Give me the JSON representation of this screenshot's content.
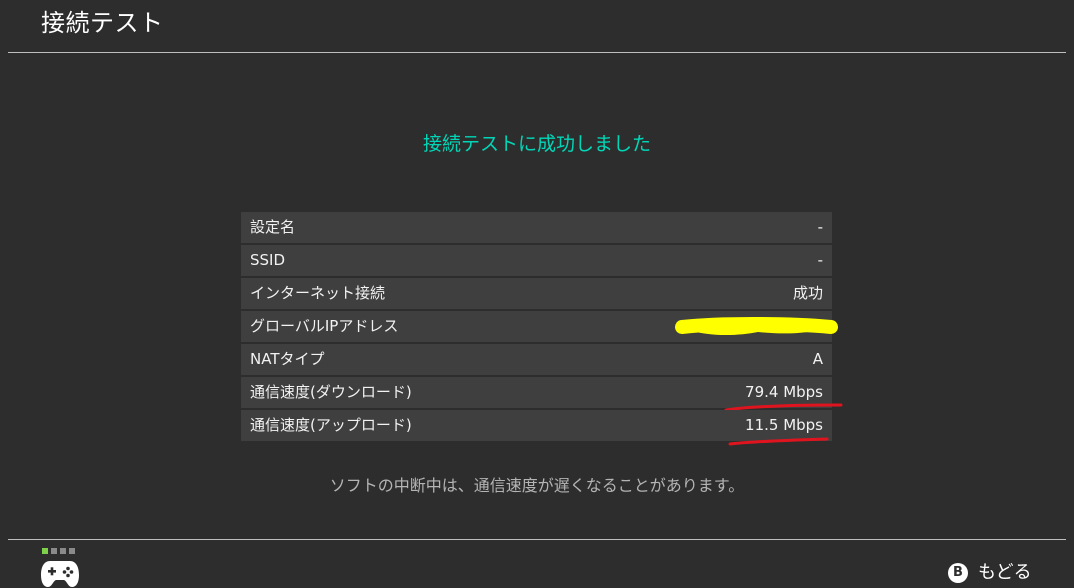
{
  "header": {
    "title": "接続テスト"
  },
  "result": {
    "message": "接続テストに成功しました",
    "color": "#00d7b8"
  },
  "rows": [
    {
      "label": "設定名",
      "value": "-"
    },
    {
      "label": "SSID",
      "value": "-"
    },
    {
      "label": "インターネット接続",
      "value": "成功"
    },
    {
      "label": "グローバルIPアドレス",
      "value": ""
    },
    {
      "label": "NATタイプ",
      "value": "A"
    },
    {
      "label": "通信速度(ダウンロード)",
      "value": "79.4 Mbps"
    },
    {
      "label": "通信速度(アップロード)",
      "value": "11.5 Mbps"
    }
  ],
  "note": "ソフトの中断中は、通信速度が遅くなることがあります。",
  "footer": {
    "controller_icon": "gamepad-icon",
    "back_button_key": "B",
    "back_label": "もどる",
    "indicator_active_color": "#7fd14a"
  },
  "annotations": {
    "redaction_color": "#ffff00",
    "underline_color": "#e0141e"
  }
}
